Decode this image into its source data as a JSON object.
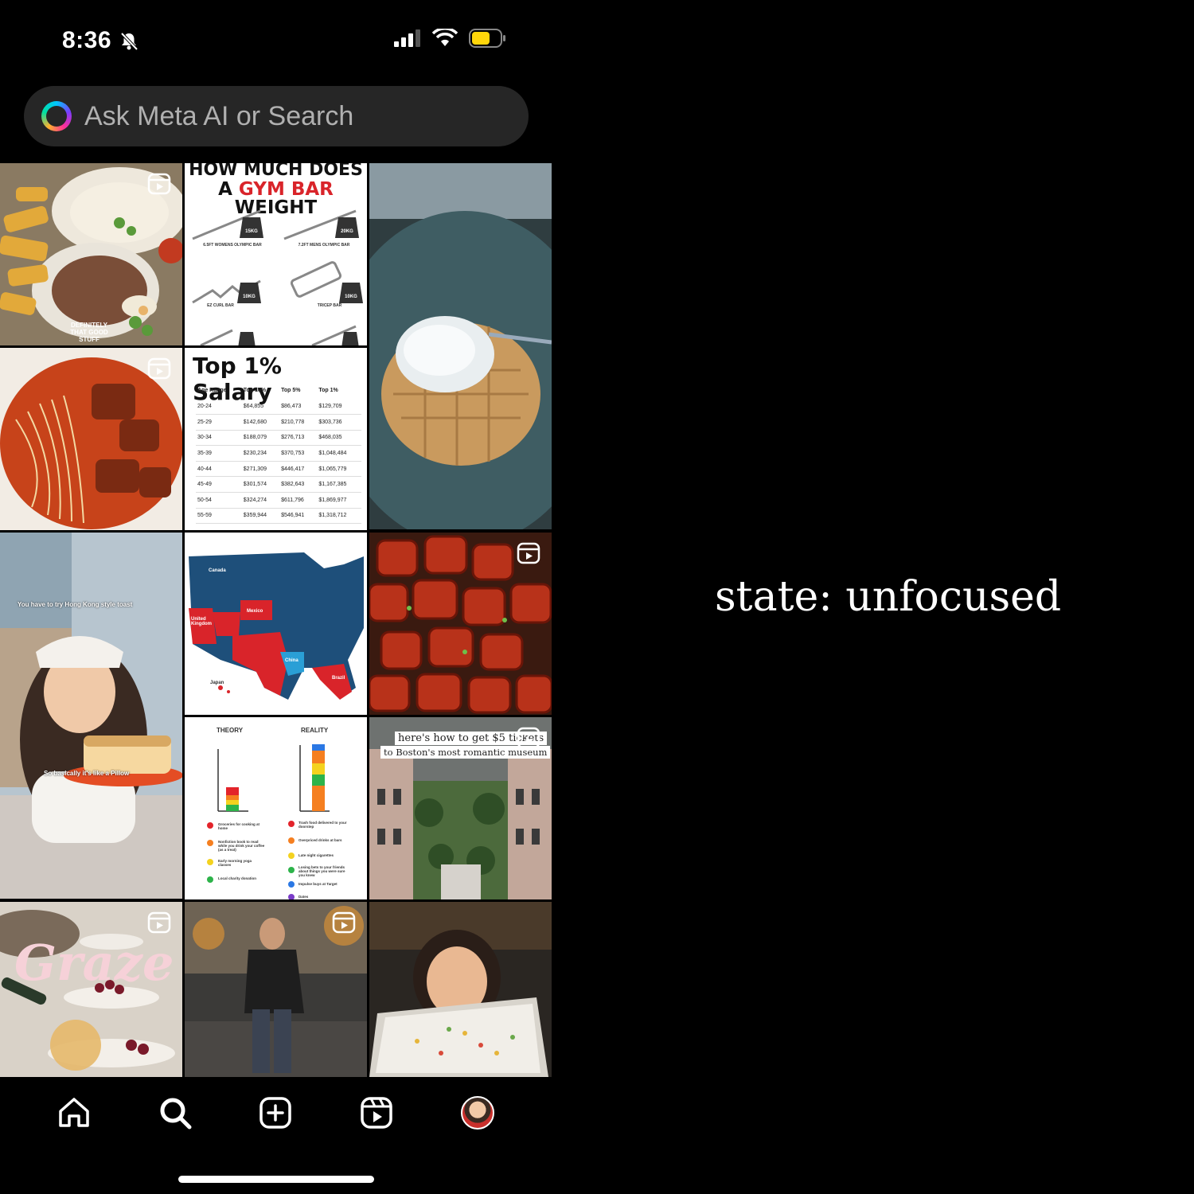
{
  "status_bar": {
    "time": "8:36",
    "icons": [
      "bell-slash-icon",
      "cellular-signal-icon",
      "wifi-icon",
      "battery-low-power-icon"
    ],
    "battery_color": "#ffd60a"
  },
  "search": {
    "placeholder": "Ask Meta AI or Search",
    "icon": "meta-ai-ring-icon"
  },
  "grid": {
    "tiles": [
      {
        "name": "congee-fried-dough",
        "caption": "DEFINITELY THAT GOOD STUFF",
        "is_reel": true
      },
      {
        "name": "gym-bar-weight",
        "title_line1": "HOW MUCH DOES",
        "title_line2_a": "A ",
        "title_line2_b": "GYM BAR",
        "title_line2_c": " WEIGHT",
        "bars": [
          "6.5FT WOMENS OLYMPIC BAR",
          "7.2FT MENS OLYMPIC BAR",
          "EZ CURL BAR",
          "TRICEP BAR"
        ],
        "weights": [
          "15KG",
          "20KG",
          "10KG",
          "10KG"
        ],
        "is_reel": false
      },
      {
        "name": "waffle-yogurt",
        "is_reel": false
      },
      {
        "name": "red-noodle-soup",
        "is_reel": true
      },
      {
        "name": "top-salary",
        "title": "Top 1% Salary",
        "headers": [
          "Age Range",
          "Top 10%",
          "Top 5%",
          "Top 1%"
        ],
        "rows": [
          [
            "20-24",
            "$64,855",
            "$86,473",
            "$129,709"
          ],
          [
            "25-29",
            "$142,680",
            "$210,778",
            "$303,736"
          ],
          [
            "30-34",
            "$188,079",
            "$276,713",
            "$468,035"
          ],
          [
            "35-39",
            "$230,234",
            "$370,753",
            "$1,048,484"
          ],
          [
            "40-44",
            "$271,309",
            "$446,417",
            "$1,065,779"
          ],
          [
            "45-49",
            "$301,574",
            "$382,643",
            "$1,167,385"
          ],
          [
            "50-54",
            "$324,274",
            "$611,796",
            "$1,869,977"
          ],
          [
            "55-59",
            "$359,944",
            "$546,941",
            "$1,318,712"
          ]
        ],
        "is_reel": false
      },
      {
        "name": "hk-toast-woman",
        "caption_top": "You have to try Hong Kong style toast",
        "caption_bottom": "So basically it's like a Pillow",
        "is_reel": false
      },
      {
        "name": "us-map-countries",
        "labels": [
          "Canada",
          "Mexico",
          "United Kingdom",
          "China",
          "Brazil",
          "Japan"
        ],
        "is_reel": false
      },
      {
        "name": "glazed-tofu",
        "is_reel": true
      },
      {
        "name": "theory-reality",
        "left_title": "THEORY",
        "right_title": "REALITY",
        "left_items": [
          "Groceries for cooking at home",
          "Nonfiction book to read while you drink your coffee (as a treat)",
          "Early morning yoga classes",
          "Local charity donation"
        ],
        "right_items": [
          "Trash food delivered to your doorstep",
          "Overpriced drinks at bars",
          "Late night cigarettes",
          "Losing bets to your friends about things you were sure you knew",
          "Impulse buys at Target",
          "Dates"
        ],
        "is_reel": false
      },
      {
        "name": "boston-museum",
        "caption_line1": "here's how to get $5 tickets",
        "caption_line2": "to Boston's most romantic museum",
        "is_reel": true
      },
      {
        "name": "graze-platter",
        "title": "Graze",
        "is_reel": true
      },
      {
        "name": "man-walking",
        "is_reel": true
      },
      {
        "name": "woman-tray",
        "is_reel": false
      }
    ]
  },
  "nav": {
    "items": [
      {
        "name": "home",
        "icon": "home-icon"
      },
      {
        "name": "search",
        "icon": "search-icon",
        "active": true
      },
      {
        "name": "create",
        "icon": "plus-square-icon"
      },
      {
        "name": "reels",
        "icon": "reels-icon"
      },
      {
        "name": "profile",
        "icon": "avatar"
      }
    ]
  },
  "annotation": {
    "state_label": "state: unfocused"
  }
}
